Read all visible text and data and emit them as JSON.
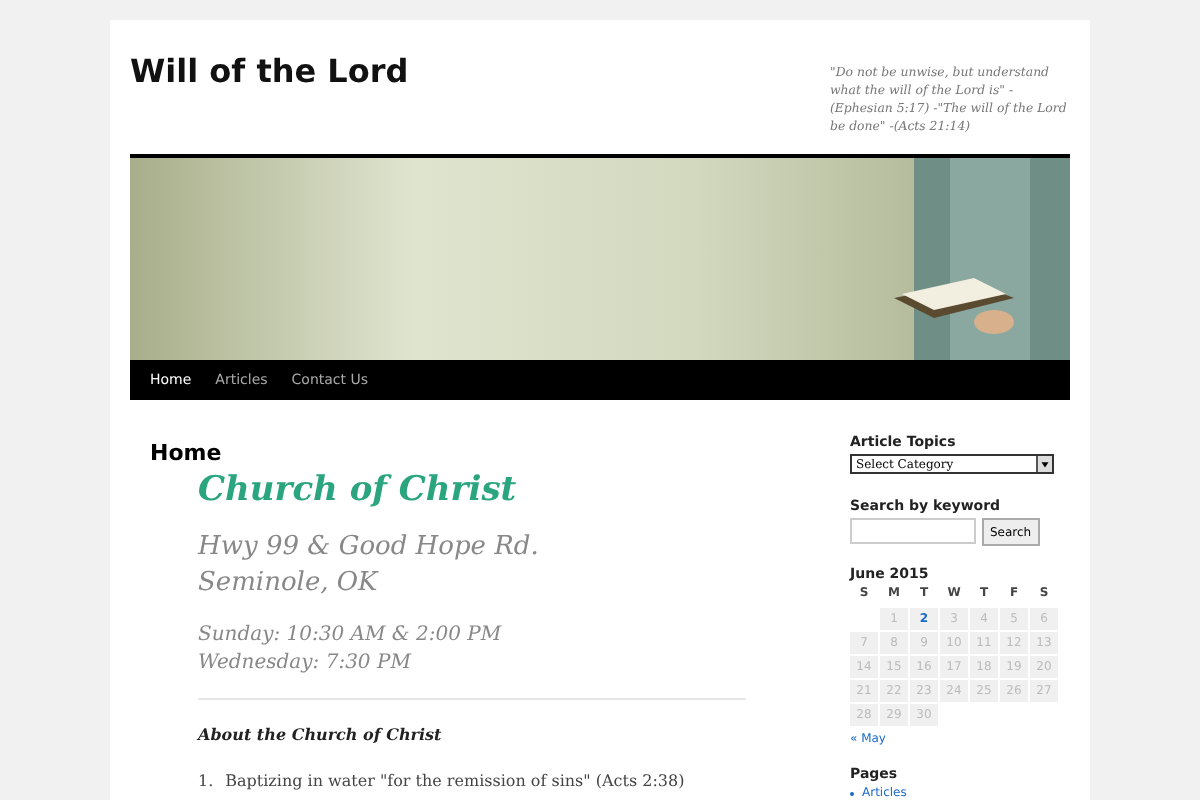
{
  "site": {
    "title": "Will of the Lord",
    "tagline": "\"Do not be unwise, but understand what the will of the Lord is\" -(Ephesian 5:17) -\"The will of the Lord be done\" -(Acts 21:14)"
  },
  "nav": [
    {
      "label": "Home",
      "selected": true
    },
    {
      "label": "Articles",
      "selected": false
    },
    {
      "label": "Contact Us",
      "selected": false
    }
  ],
  "content": {
    "page_title": "Home",
    "heading": "Church of Christ",
    "address": [
      "Hwy 99 & Good Hope Rd.",
      "Seminole, OK"
    ],
    "times": [
      "Sunday: 10:30 AM & 2:00 PM",
      "Wednesday: 7:30 PM"
    ],
    "subheading": "About the Church of Christ",
    "list": [
      {
        "number": "1.",
        "text": "Baptizing in water \"for the remission of sins\" (Acts 2:38)"
      }
    ]
  },
  "sidebar": {
    "topics": {
      "title": "Article Topics",
      "value": "Select Category"
    },
    "search": {
      "title": "Search by keyword",
      "button": "Search"
    },
    "calendar": {
      "title": "June 2015",
      "weekdays": [
        "S",
        "M",
        "T",
        "W",
        "T",
        "F",
        "S"
      ],
      "days": [
        {
          "label": "1",
          "linked": false
        },
        {
          "label": "2",
          "linked": true
        },
        {
          "label": "3",
          "linked": false
        },
        {
          "label": "4",
          "linked": false
        },
        {
          "label": "5",
          "linked": false
        },
        {
          "label": "6",
          "linked": false
        },
        {
          "label": "7",
          "linked": false
        },
        {
          "label": "8",
          "linked": false
        },
        {
          "label": "9",
          "linked": false
        },
        {
          "label": "10",
          "linked": false
        },
        {
          "label": "11",
          "linked": false
        },
        {
          "label": "12",
          "linked": false
        },
        {
          "label": "13",
          "linked": false
        },
        {
          "label": "14",
          "linked": false
        },
        {
          "label": "15",
          "linked": false
        },
        {
          "label": "16",
          "linked": false
        },
        {
          "label": "17",
          "linked": false
        },
        {
          "label": "18",
          "linked": false
        },
        {
          "label": "19",
          "linked": false
        },
        {
          "label": "20",
          "linked": false
        },
        {
          "label": "21",
          "linked": false
        },
        {
          "label": "22",
          "linked": false
        },
        {
          "label": "23",
          "linked": false
        },
        {
          "label": "24",
          "linked": false
        },
        {
          "label": "25",
          "linked": false
        },
        {
          "label": "26",
          "linked": false
        },
        {
          "label": "27",
          "linked": false
        },
        {
          "label": "28",
          "linked": false
        },
        {
          "label": "29",
          "linked": false
        },
        {
          "label": "30",
          "linked": false
        }
      ],
      "prev": "« May"
    },
    "pages": {
      "title": "Pages",
      "items": [
        "Articles"
      ]
    }
  }
}
